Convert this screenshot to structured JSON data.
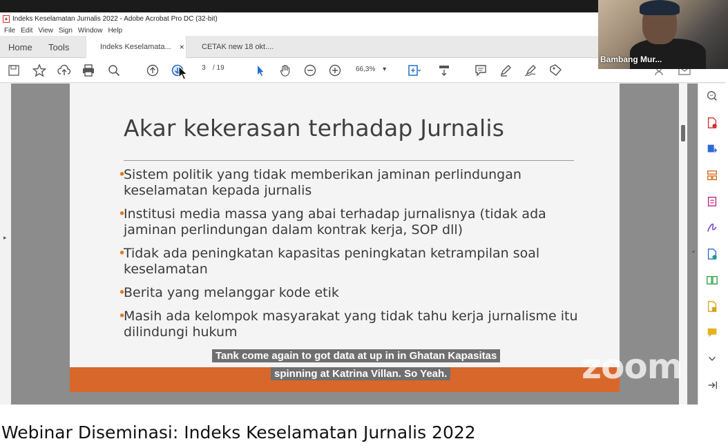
{
  "window": {
    "title": "Indeks Keselamatan Jurnalis 2022 - Adobe Acrobat Pro DC (32-bit)",
    "menu": [
      "File",
      "Edit",
      "View",
      "Sign",
      "Window",
      "Help"
    ]
  },
  "tabs": {
    "home": "Home",
    "tools": "Tools",
    "doc1": "Indeks Keselamata...",
    "doc1_close": "×",
    "doc2": "CETAK new 18 okt...."
  },
  "toolbar": {
    "page_current": "3",
    "page_total": "/ 19",
    "zoom": "66,3%",
    "zoom_caret": "▾"
  },
  "slide": {
    "title": "Akar kekerasan terhadap Jurnalis",
    "bullet_char": "•",
    "bullets": [
      "Sistem politik yang tidak memberikan jaminan perlindungan keselamatan kepada jurnalis",
      "Institusi media massa yang abai terhadap jurnalisnya (tidak ada jaminan perlindungan dalam kontrak kerja, SOP dll)",
      "Tidak ada peningkatan kapasitas peningkatan ketrampilan soal keselamatan",
      "Berita yang melanggar kode etik",
      "Masih ada kelompok masyarakat yang tidak tahu kerja jurnalisme itu dilindungi hukum"
    ]
  },
  "captions": {
    "line1": "Tank come again to got data at up in in Ghatan Kapasitas",
    "line2": "spinning at Katrina Villan. So Yeah."
  },
  "watermark": "zoom",
  "video": {
    "participant_name": "Bambang Mur..."
  },
  "footer": {
    "title": "Webinar Diseminasi: Indeks Keselamatan Jurnalis 2022"
  },
  "colors": {
    "accent_blue": "#1f6fd1",
    "slide_band": "#d8672c",
    "bullet_orange": "#e07a1f",
    "pdf_red": "#d32f2f"
  }
}
